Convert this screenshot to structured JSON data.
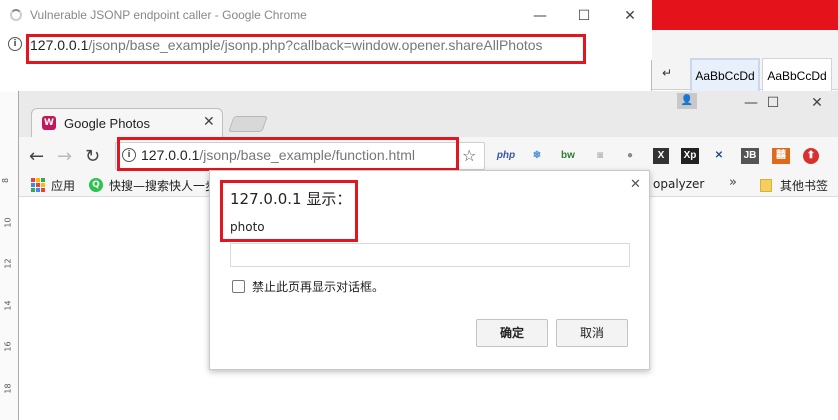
{
  "popup_window": {
    "title": "Vulnerable JSONP endpoint caller - Google Chrome",
    "url_host": "127.0.0.1",
    "url_path": "/jsonp/base_example/jsonp.php?callback=window.opener.shareAllPhotos",
    "info_glyph": "i",
    "controls": {
      "minimize": "—",
      "maximize": "☐",
      "close": "✕"
    }
  },
  "background_app": {
    "undo_glyph": "↵",
    "styles": [
      "AaBbCcDd",
      "AaBbCcDd"
    ]
  },
  "browser": {
    "tab": {
      "title": "Google Photos",
      "close": "✕",
      "favicon_glyph": "W"
    },
    "user_glyph": "👤",
    "controls": {
      "minimize": "—",
      "maximize": "☐",
      "close": "✕"
    },
    "nav": {
      "back": "←",
      "forward": "→",
      "reload": "↻"
    },
    "info_glyph": "i",
    "url_host": "127.0.0.1",
    "url_path": "/jsonp/base_example/function.html",
    "star": "☆",
    "extensions": [
      "php",
      "❄",
      "bw",
      "◙",
      "●",
      "X",
      "Xp",
      "✕",
      "JB",
      "囍",
      "⬆"
    ],
    "bookmarks": {
      "apps_label": "应用",
      "quick_glyph": "Q",
      "quick_label": "快搜—搜索快人一步",
      "partial_label": "opalyzer",
      "more": "»",
      "other_label": "其他书签"
    },
    "ruler": [
      "8",
      "10",
      "12",
      "14",
      "16",
      "18"
    ]
  },
  "dialog": {
    "title": "127.0.0.1 显示：",
    "message": "photo",
    "input_value": "",
    "checkbox_label": "禁止此页再显示对话框。",
    "ok_label": "确定",
    "cancel_label": "取消",
    "close": "✕"
  },
  "colors": {
    "highlight": "#e2161f",
    "word_brand": "#e3121b"
  }
}
